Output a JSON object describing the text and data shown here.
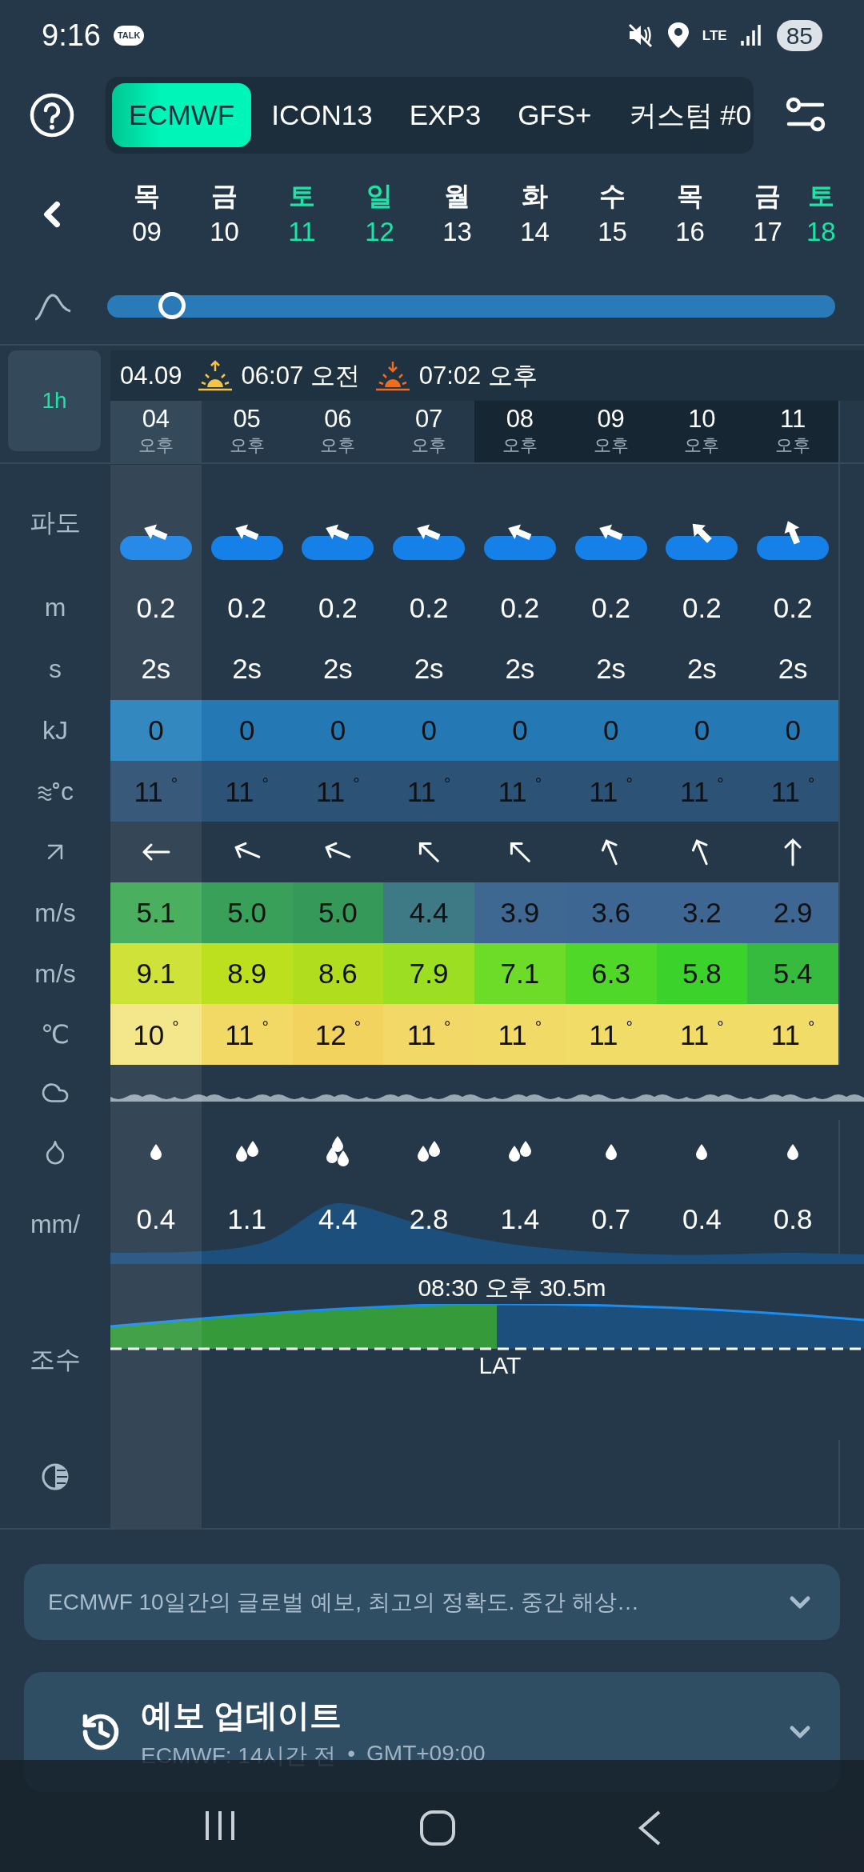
{
  "status_bar": {
    "time": "9:16",
    "notification": "TALK",
    "network": "LTE",
    "battery": "85"
  },
  "model_tabs": [
    {
      "label": "ECMWF",
      "selected": true
    },
    {
      "label": "ICON13",
      "selected": false
    },
    {
      "label": "EXP3",
      "selected": false
    },
    {
      "label": "GFS+",
      "selected": false
    },
    {
      "label": "커스텀 #0",
      "selected": false
    }
  ],
  "days": [
    {
      "weekday": "목",
      "date": "09",
      "weekend": false
    },
    {
      "weekday": "금",
      "date": "10",
      "weekend": false
    },
    {
      "weekday": "토",
      "date": "11",
      "weekend": true
    },
    {
      "weekday": "일",
      "date": "12",
      "weekend": true
    },
    {
      "weekday": "월",
      "date": "13",
      "weekend": false
    },
    {
      "weekday": "화",
      "date": "14",
      "weekend": false
    },
    {
      "weekday": "수",
      "date": "15",
      "weekend": false
    },
    {
      "weekday": "목",
      "date": "16",
      "weekend": false
    },
    {
      "weekday": "금",
      "date": "17",
      "weekend": false
    },
    {
      "weekday": "토",
      "date": "18",
      "weekend": true
    }
  ],
  "timeline": {
    "level": 0.09
  },
  "grid": {
    "interval": "1h",
    "date": "04.09",
    "sunrise": "06:07 오전",
    "sunset": "07:02 오후",
    "hours": [
      {
        "hour": "04",
        "period": "오후",
        "selected": true,
        "night": false
      },
      {
        "hour": "05",
        "period": "오후",
        "selected": false,
        "night": false
      },
      {
        "hour": "06",
        "period": "오후",
        "selected": false,
        "night": false
      },
      {
        "hour": "07",
        "period": "오후",
        "selected": false,
        "night": false
      },
      {
        "hour": "08",
        "period": "오후",
        "selected": false,
        "night": true
      },
      {
        "hour": "09",
        "period": "오후",
        "selected": false,
        "night": true
      },
      {
        "hour": "10",
        "period": "오후",
        "selected": false,
        "night": true
      },
      {
        "hour": "11",
        "period": "오후",
        "selected": false,
        "night": true
      }
    ],
    "rows": [
      {
        "kind": "waves",
        "label": "파도",
        "cells": [
          {
            "kind": "wnw"
          },
          {
            "kind": "wnw"
          },
          {
            "kind": "wnw"
          },
          {
            "kind": "wnw"
          },
          {
            "kind": "wnw"
          },
          {
            "kind": "wnw"
          },
          {
            "kind": "nw"
          },
          {
            "kind": "nnw"
          }
        ]
      },
      {
        "kind": "text",
        "label": "m",
        "cells": [
          {
            "value": "0.2"
          },
          {
            "value": "0.2"
          },
          {
            "value": "0.2"
          },
          {
            "value": "0.2"
          },
          {
            "value": "0.2"
          },
          {
            "value": "0.2"
          },
          {
            "value": "0.2"
          },
          {
            "value": "0.2"
          }
        ]
      },
      {
        "kind": "text",
        "label": "s",
        "cells": [
          {
            "value": "2s"
          },
          {
            "value": "2s"
          },
          {
            "value": "2s"
          },
          {
            "value": "2s"
          },
          {
            "value": "2s"
          },
          {
            "value": "2s"
          },
          {
            "value": "2s"
          },
          {
            "value": "2s"
          }
        ]
      },
      {
        "kind": "colored",
        "label": "kJ",
        "cells": [
          {
            "value": "0",
            "color": "#3388c0"
          },
          {
            "value": "0",
            "color": "#2479b5"
          },
          {
            "value": "0",
            "color": "#2479b5"
          },
          {
            "value": "0",
            "color": "#2479b5"
          },
          {
            "value": "0",
            "color": "#2479b5"
          },
          {
            "value": "0",
            "color": "#2479b5"
          },
          {
            "value": "0",
            "color": "#2479b5"
          },
          {
            "value": "0",
            "color": "#2479b5"
          }
        ]
      },
      {
        "kind": "water",
        "label": "c",
        "cells": [
          {
            "value": "11$^{°}$",
            "color": "#38597a"
          },
          {
            "value": "11$^{°}$",
            "color": "#2c5275"
          },
          {
            "value": "11$^{°}$",
            "color": "#2c5275"
          },
          {
            "value": "11$^{°}$",
            "color": "#2c5275"
          },
          {
            "value": "11$^{°}$",
            "color": "#2c5275"
          },
          {
            "value": "11$^{°}$",
            "color": "#2c5275"
          },
          {
            "value": "11$^{°}$",
            "color": "#2c5275"
          },
          {
            "value": "11$^{°}$",
            "color": "#2c5275"
          }
        ]
      },
      {
        "kind": "wind_direction",
        "cells": [
          {
            "kind": "w"
          },
          {
            "kind": "wnw"
          },
          {
            "kind": "wnw"
          },
          {
            "kind": "nw"
          },
          {
            "kind": "nw"
          },
          {
            "kind": "nnw"
          },
          {
            "kind": "nnw"
          },
          {
            "kind": "n"
          }
        ]
      },
      {
        "kind": "colored",
        "label": "m/s",
        "cells": [
          {
            "value": "5.1",
            "color": "#4ab060"
          },
          {
            "value": "5.0",
            "color": "#38a058"
          },
          {
            "value": "5.0",
            "color": "#35995a"
          },
          {
            "value": "4.4",
            "color": "#3d7a85"
          },
          {
            "value": "3.9",
            "color": "#3e6892"
          },
          {
            "value": "3.6",
            "color": "#3d6692"
          },
          {
            "value": "3.2",
            "color": "#3d6692"
          },
          {
            "value": "2.9",
            "color": "#3d6692"
          }
        ]
      },
      {
        "kind": "colored",
        "label": "m/s",
        "cells": [
          {
            "value": "9.1",
            "color": "#cfe23a"
          },
          {
            "value": "8.9",
            "color": "#bde01e"
          },
          {
            "value": "8.6",
            "color": "#b0de1e"
          },
          {
            "value": "7.9",
            "color": "#9cde22"
          },
          {
            "value": "7.1",
            "color": "#6ddc28"
          },
          {
            "value": "6.3",
            "color": "#4fd828"
          },
          {
            "value": "5.8",
            "color": "#3cd22c"
          },
          {
            "value": "5.4",
            "color": "#36bb3e"
          }
        ]
      },
      {
        "kind": "colored",
        "label": "℃",
        "cells": [
          {
            "value": "10$^{°}$",
            "color": "#f4e68a"
          },
          {
            "value": "11$^{°}$",
            "color": "#f2d966"
          },
          {
            "value": "12$^{°}$",
            "color": "#f2d35e"
          },
          {
            "value": "11$^{°}$",
            "color": "#f2d866"
          },
          {
            "value": "11$^{°}$",
            "color": "#f1da66"
          },
          {
            "value": "11$^{°}$",
            "color": "#f1dc68"
          },
          {
            "value": "11$^{°}$",
            "color": "#f1dc68"
          },
          {
            "value": "11$^{°}$",
            "color": "#f1dc68"
          }
        ]
      },
      {
        "kind": "clouds"
      },
      {
        "kind": "drops",
        "cells": [
          {
            "kind": "light"
          },
          {
            "kind": "moderate"
          },
          {
            "kind": "heavy"
          },
          {
            "kind": "moderate"
          },
          {
            "kind": "moderate"
          },
          {
            "kind": "light"
          },
          {
            "kind": "light"
          },
          {
            "kind": "light"
          }
        ]
      },
      {
        "kind": "precip",
        "label": "mm/",
        "cells": [
          {
            "value": "0.4"
          },
          {
            "value": "1.1"
          },
          {
            "value": "4.4"
          },
          {
            "value": "2.8"
          },
          {
            "value": "1.4"
          },
          {
            "value": "0.7"
          },
          {
            "value": "0.4"
          },
          {
            "value": "0.8"
          }
        ]
      },
      {
        "kind": "tide",
        "label": "조수",
        "high": "08:30 오후 30.5m",
        "datum": "LAT"
      },
      {
        "kind": "moon"
      }
    ]
  },
  "cards": {
    "description": "ECMWF 10일간의 글로벌 예보, 최고의 정확도. 중간 해상…",
    "update_title": "예보 업데이트",
    "update_source": "ECMWF: 14시간 전",
    "separator": "•",
    "timezone": "GMT+09:00"
  }
}
